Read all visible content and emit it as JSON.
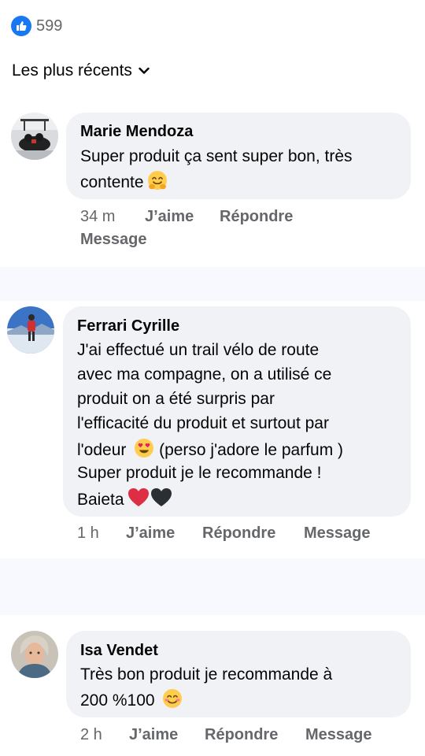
{
  "reactions": {
    "count": "599",
    "icon": "thumbs-up-icon",
    "color": "#1877f2"
  },
  "sort": {
    "label": "Les plus récents"
  },
  "comments": [
    {
      "author": "Marie Mendoza",
      "lines": [
        "Super produit ça sent super bon, très",
        "contente"
      ],
      "emoji": "hugging-face-emoji",
      "time": "34 m",
      "like": "J’aime",
      "reply": "Répondre",
      "message": "Message"
    },
    {
      "author": "Ferrari Cyrille",
      "lines": [
        "J'ai effectué un trail vélo de route",
        "avec ma compagne, on a utilisé ce",
        "produit on a été surpris par",
        "l'efficacité du produit et surtout par",
        "l'odeur",
        "(perso j'adore le parfum )",
        "Super produit je le recommande !",
        "Baieta"
      ],
      "emojis": [
        "heart-eyes-emoji",
        "red-heart-emoji",
        "black-heart-emoji"
      ],
      "time": "1 h",
      "like": "J’aime",
      "reply": "Répondre",
      "message": "Message"
    },
    {
      "author": "Isa Vendet",
      "lines": [
        "Très bon produit je recommande à",
        "200 %100"
      ],
      "emoji": "smiling-face-emoji",
      "time": "2 h",
      "like": "J’aime",
      "reply": "Répondre",
      "message": "Message"
    }
  ]
}
